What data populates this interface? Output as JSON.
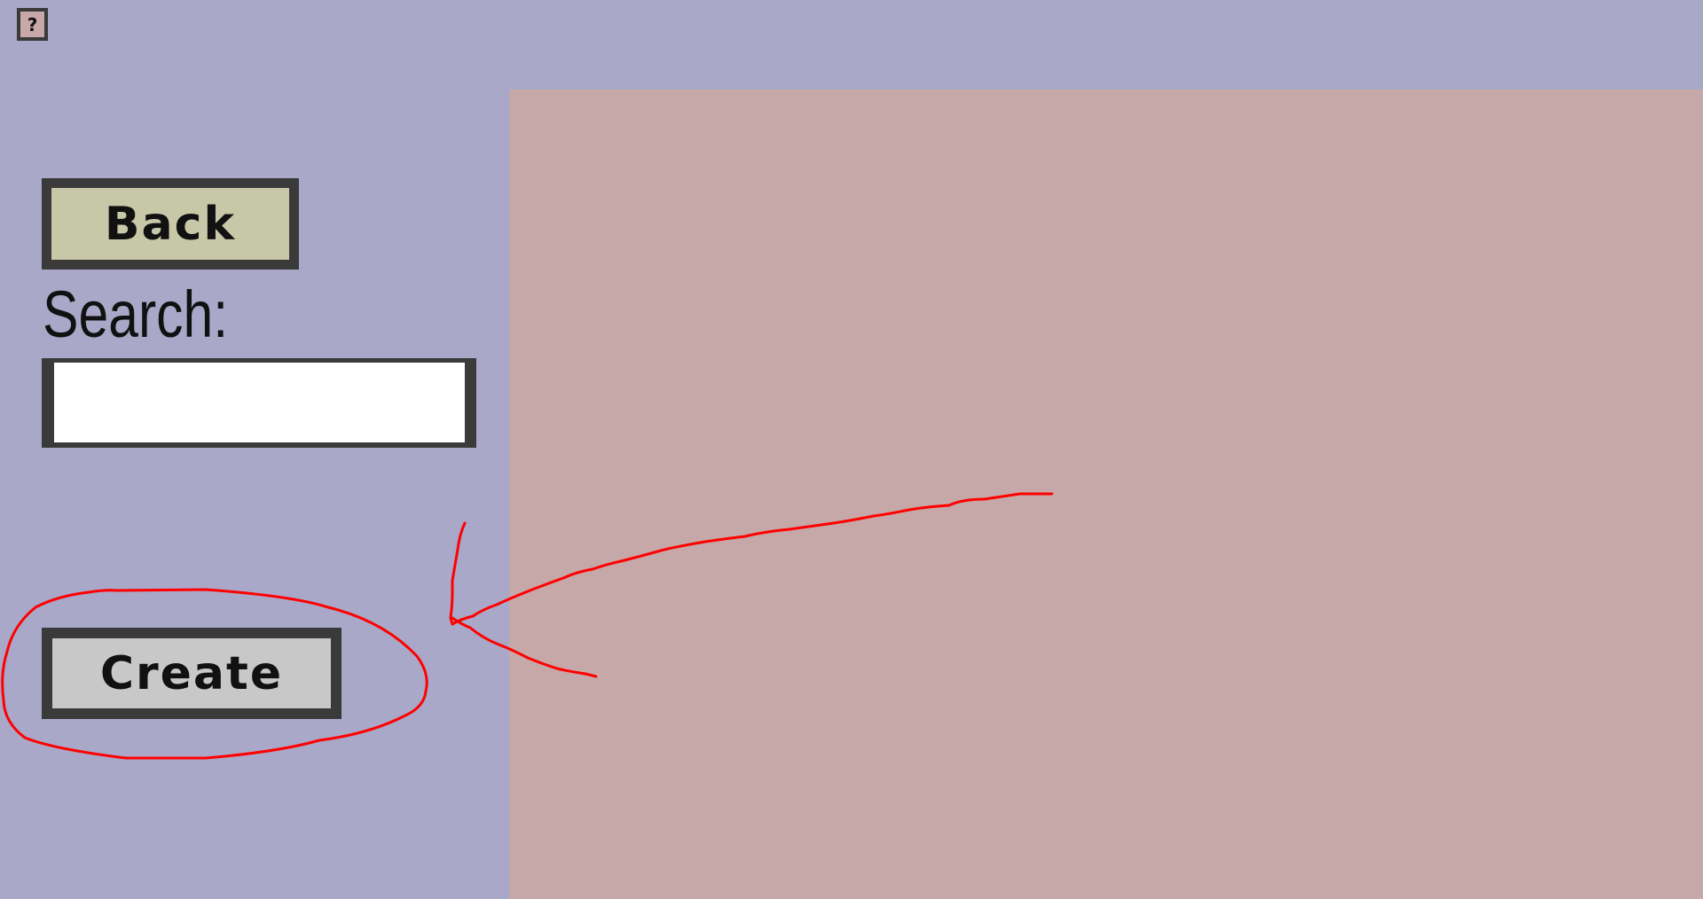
{
  "toolbar": {
    "help_label": "?"
  },
  "sidebar": {
    "back_label": "Back",
    "search_label": "Search:",
    "search_value": "",
    "search_placeholder": "",
    "create_label": "Create"
  },
  "colors": {
    "background": "#a9a8c8",
    "content_panel": "#c7a8a9",
    "back_button": "#c7c8a8",
    "create_button": "#c8c8c8",
    "help_button": "#c8a8a8",
    "button_border": "#3a3a3a",
    "annotation": "#ff0000"
  },
  "annotation": {
    "type": "red-freehand-arrow-and-circle",
    "target": "Create"
  }
}
